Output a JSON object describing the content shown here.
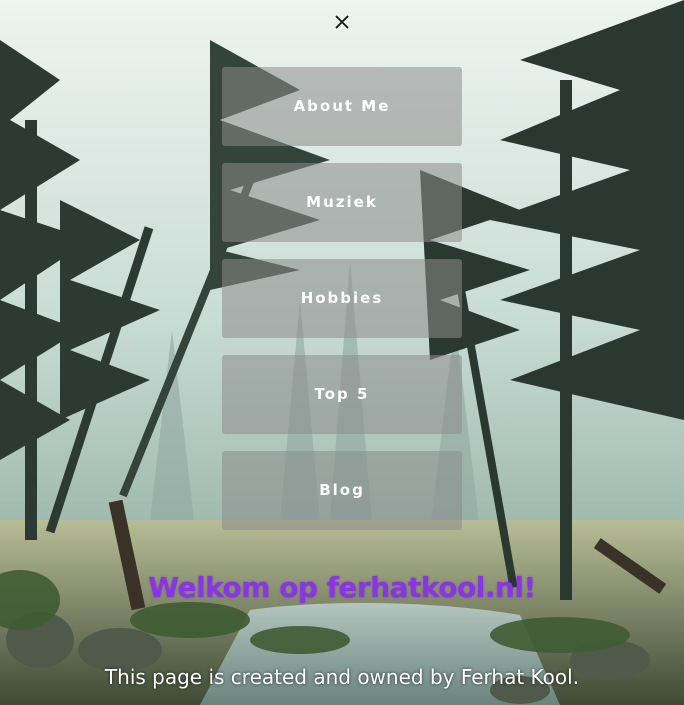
{
  "nav": {
    "close_icon": "close-icon",
    "items": [
      {
        "label": "About Me"
      },
      {
        "label": "Muziek"
      },
      {
        "label": "Hobbies"
      },
      {
        "label": "Top 5"
      },
      {
        "label": "Blog"
      }
    ]
  },
  "main": {
    "welcome": "Welkom op ferhatkool.nl!",
    "footer": "This page is created and owned by Ferhat Kool."
  },
  "colors": {
    "welcome_text": "#8a33e8",
    "menu_item_bg": "rgba(140,140,140,0.55)",
    "menu_text": "#ffffff"
  }
}
